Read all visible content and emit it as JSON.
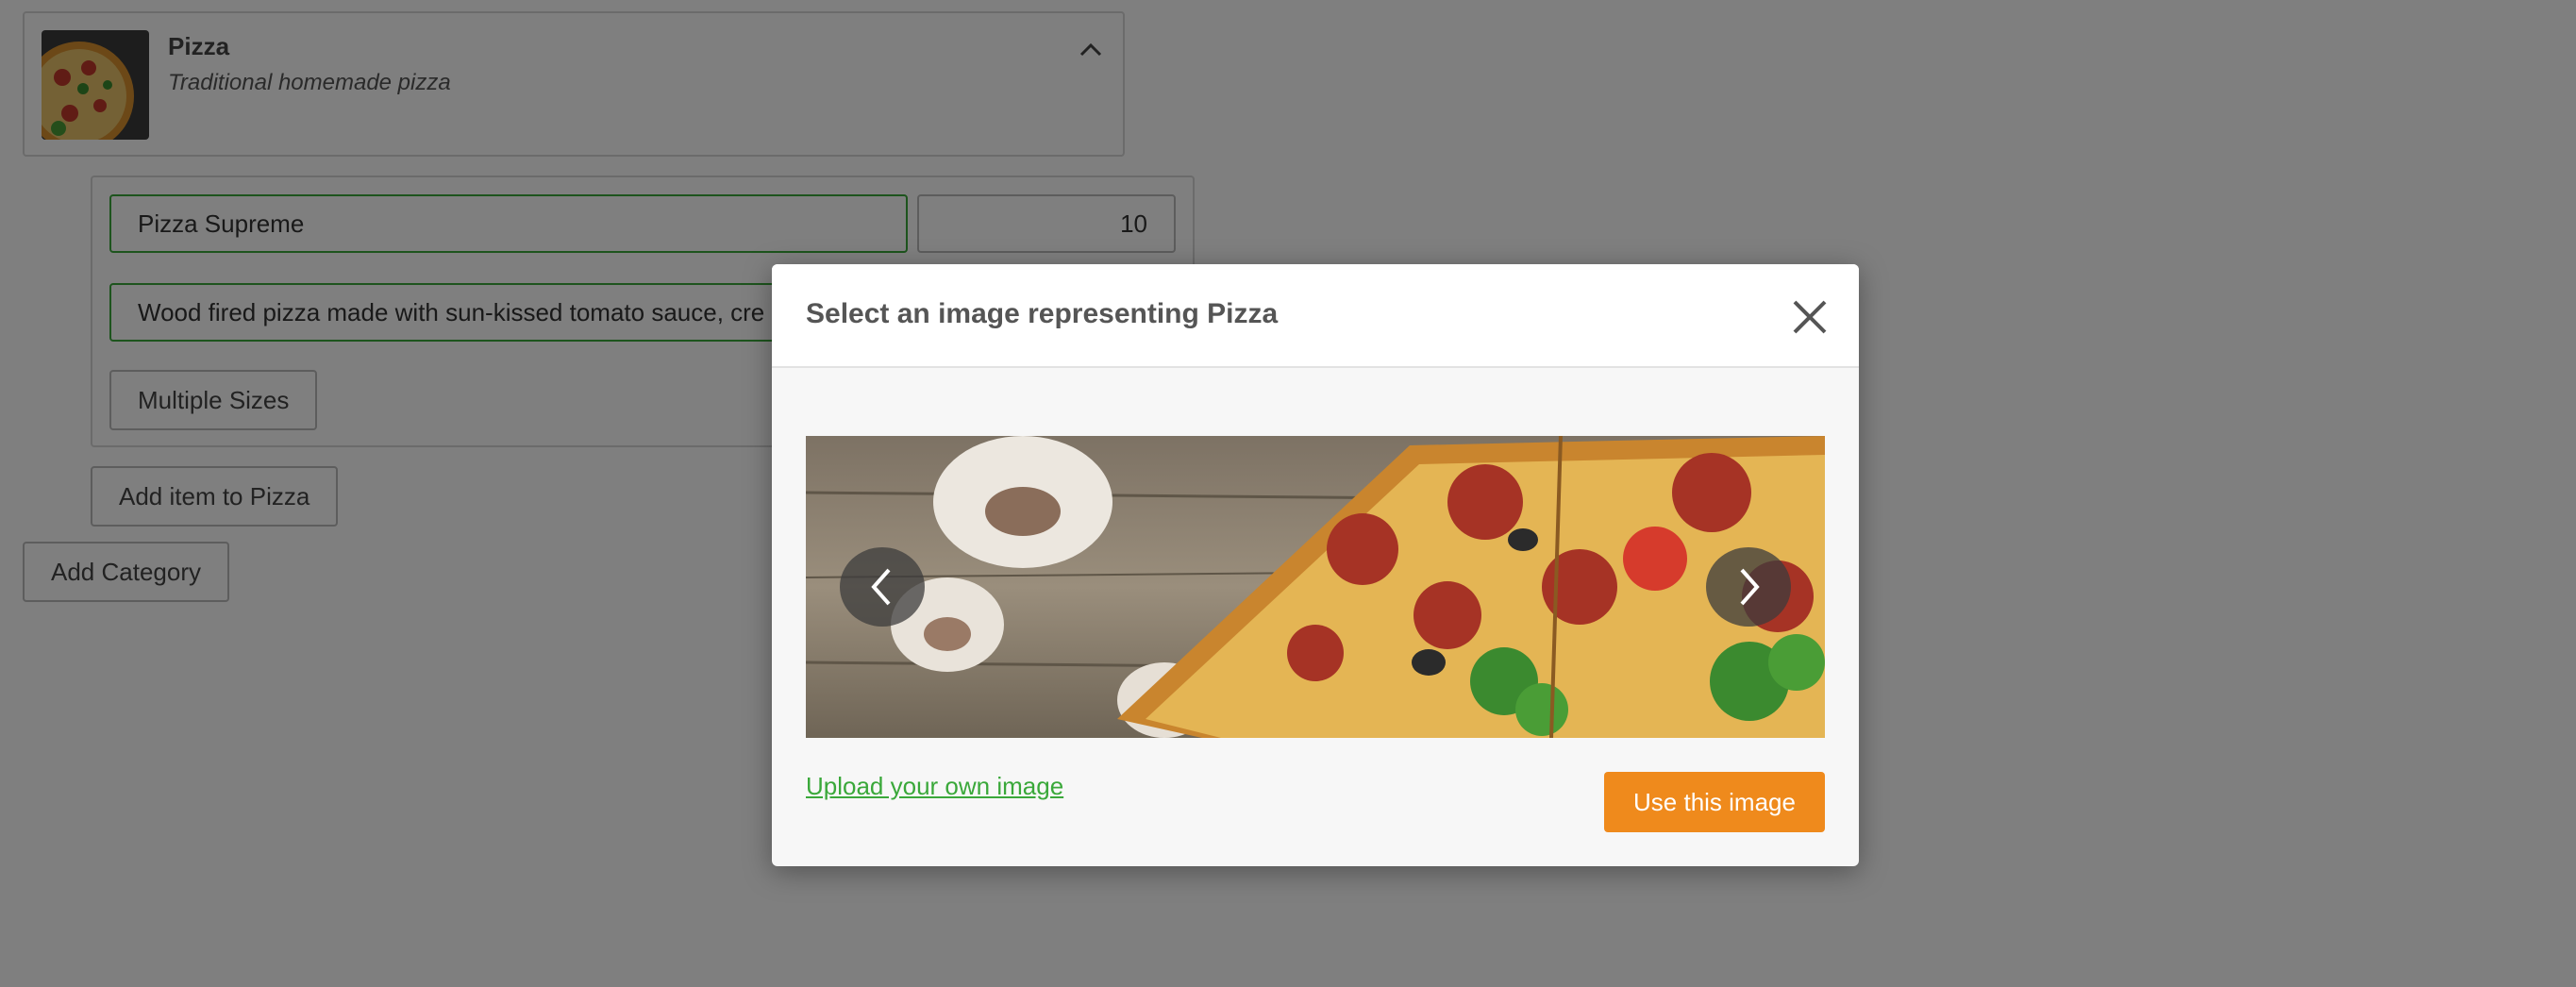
{
  "category": {
    "name": "Pizza",
    "description": "Traditional homemade pizza"
  },
  "item": {
    "name_value": "Pizza Supreme",
    "price_value": "10",
    "description_value": "Wood fired pizza made with sun-kissed tomato sauce, cre",
    "multiple_sizes_label": "Multiple Sizes"
  },
  "actions": {
    "add_item_label": "Add item to Pizza",
    "add_category_label": "Add Category"
  },
  "modal": {
    "title": "Select an image representing Pizza",
    "upload_link_label": "Upload your own image",
    "use_button_label": "Use this image"
  },
  "colors": {
    "accent_green": "#3aa83a",
    "primary_orange": "#ef8a1c",
    "overlay": "rgba(0,0,0,0.5)"
  },
  "icons": {
    "collapse": "chevron-up-icon",
    "close": "close-icon",
    "prev": "chevron-left-icon",
    "next": "chevron-right-icon"
  }
}
